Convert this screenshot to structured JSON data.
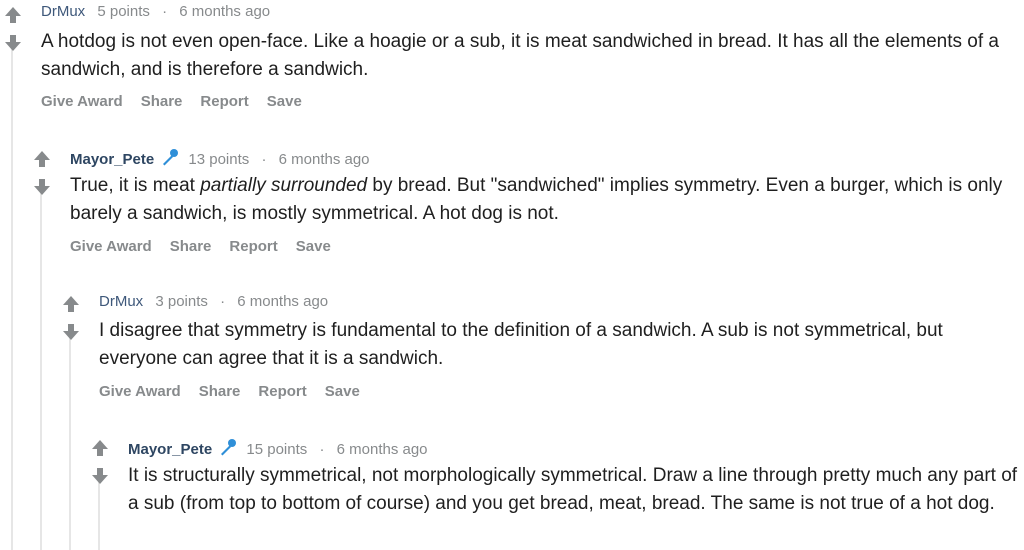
{
  "comments": [
    {
      "author": "DrMux",
      "points": "5 points",
      "time": "6 months ago",
      "body": "A hotdog is not even open-face. Like a hoagie or a sub, it is meat sandwiched in bread. It has all the elements of a sandwich, and is therefore a sandwich."
    },
    {
      "author": "Mayor_Pete",
      "points": "13 points",
      "time": "6 months ago",
      "body_pre": "True, it is meat ",
      "body_em": "partially surrounded",
      "body_post": " by bread. But \"sandwiched\" implies symmetry. Even a burger, which is only barely a sandwich, is mostly symmetrical. A hot dog is not."
    },
    {
      "author": "DrMux",
      "points": "3 points",
      "time": "6 months ago",
      "body": "I disagree that symmetry is fundamental to the definition of a sandwich. A sub is not symmetrical, but everyone can agree that it is a sandwich."
    },
    {
      "author": "Mayor_Pete",
      "points": "15 points",
      "time": "6 months ago",
      "body": "It is structurally symmetrical, not morphologically symmetrical. Draw a line through pretty much any part of a sub (from top to bottom of course) and you get bread, meat, bread. The same is not true of a hot dog."
    }
  ],
  "actions": {
    "give_award": "Give Award",
    "share": "Share",
    "report": "Report",
    "save": "Save"
  },
  "separator": "·",
  "icons": {
    "upvote": "arrow-up-icon",
    "downvote": "arrow-down-icon",
    "flair": "microphone-icon"
  },
  "colors": {
    "author": "#3e587a",
    "meta": "#878a8c",
    "vote_arrow": "#878a8c",
    "flair": "#2f8fd8"
  }
}
